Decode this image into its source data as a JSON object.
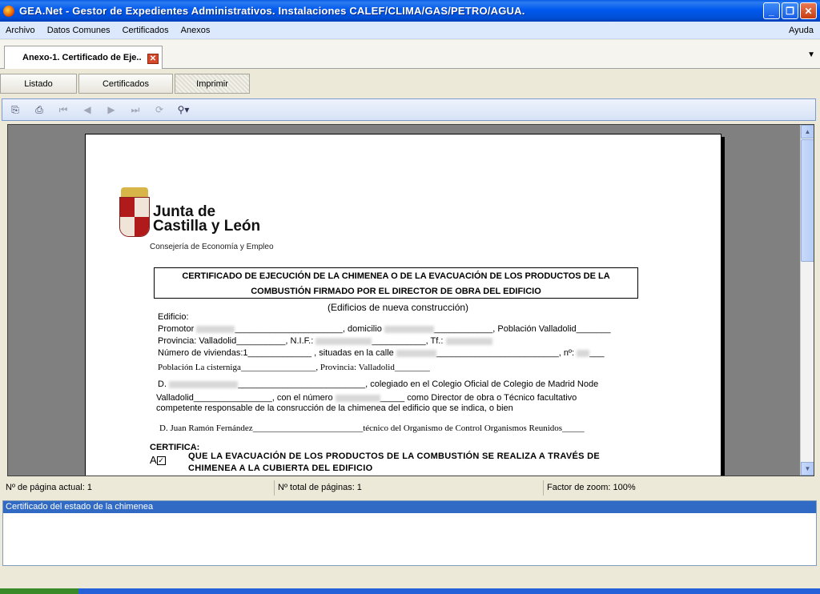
{
  "window": {
    "title": "GEA.Net - Gestor de Expedientes Administrativos. Instalaciones CALEF/CLIMA/GAS/PETRO/AGUA.",
    "controls": [
      "_",
      "❐",
      "✕"
    ]
  },
  "menu": {
    "items": [
      "Archivo",
      "Datos Comunes",
      "Certificados",
      "Anexos"
    ],
    "help": "Ayuda"
  },
  "doc_tab": {
    "label": "Anexo-1. Certificado de Eje..",
    "close": "✕",
    "menu_glyph": "▼"
  },
  "subtabs": [
    "Listado",
    "Certificados",
    "Imprimir"
  ],
  "toolbar": {
    "icons": [
      "export-icon",
      "print-icon",
      "first-page-icon",
      "prev-page-icon",
      "next-page-icon",
      "last-page-icon",
      "refresh-icon",
      "zoom-icon"
    ]
  },
  "document": {
    "logo_line1": "Junta de",
    "logo_line2": "Castilla y León",
    "logo_sub": "Consejería de Economía y Empleo",
    "heading1": "CERTIFICADO DE EJECUCIÓN DE LA  CHIMENEA O DE LA  EVACUACIÓN DE LOS PRODUCTOS  DE LA",
    "heading2": "COMBUSTIÓN FIRMADO POR EL DIRECTOR DE OBRA DEL EDIFICIO",
    "subtitle": "(Edificios de nueva construcción)",
    "edificio": "Edificio:",
    "promotor_label": "Promotor",
    "promotor_rest": "______________________,  domicilio",
    "promotor_tail": "____________,  Población Valladolid_______",
    "provincia_line": "Provincia:  Valladolid__________, N.I.F.:",
    "tf_label": "___________,  Tf.:",
    "viviendas_label": "Número de viviendas:1_____________   , situadas en la calle",
    "viviendas_tail": "_________________________, nº:",
    "poblacion_line": "Población  La cisterniga_________________, Provincia:  Valladolid________",
    "d1_label": "D.",
    "d1_tail": "__________________________, colegiado en el Colegio Oficial de Colegio de Madrid Node",
    "d1_line2": "Valladolid________________, con el número",
    "d1_line2_tail": "_____  como Director de obra o Técnico facultativo",
    "d1_line3": "competente responsable de la consrucción de la chimenea del edificio que se indica, o bien",
    "d2_line": "D.   Juan Ramón Fernández_________________________técnico del Organismo de Control Organismos Reunidos_____",
    "certifica": "CERTIFICA:",
    "opt_a": "A",
    "opt_a_check": "✓",
    "opt_a_text1": "QUE LA EVACUACIÓN  DE LOS PRODUCTOS  DE LA COMBUSTIÓN  SE REALIZA  A TRAVÉS  DE",
    "opt_a_text2": "CHIMENEA A LA CUBIERTA DEL EDIFICIO"
  },
  "status": {
    "page_current": "Nº de página actual: 1",
    "page_total": "Nº total de páginas: 1",
    "zoom": "Factor de zoom: 100%"
  },
  "list": {
    "selected": "Certificado del estado de la chimenea"
  }
}
